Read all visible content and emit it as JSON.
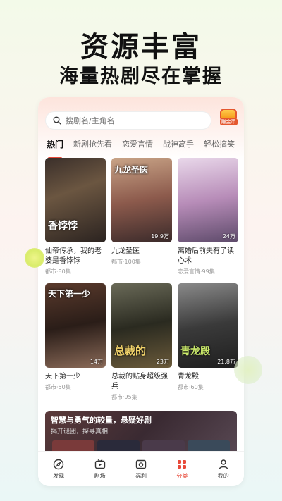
{
  "promo": {
    "title": "资源丰富",
    "subtitle": "海量热剧尽在掌握"
  },
  "search": {
    "placeholder": "搜剧名/主角名"
  },
  "coin_button": {
    "label": "赚金币"
  },
  "tabs": [
    {
      "label": "热门",
      "active": true
    },
    {
      "label": "新剧抢先看",
      "active": false
    },
    {
      "label": "恋爱言情",
      "active": false
    },
    {
      "label": "战神高手",
      "active": false
    },
    {
      "label": "轻松搞笑",
      "active": false
    }
  ],
  "dramas": [
    {
      "title": "仙帝传承，我的老婆是香饽饽",
      "meta": "都市·80集",
      "views": "",
      "poster_text": "香饽饽"
    },
    {
      "title": "九龙圣医",
      "meta": "都市·100集",
      "views": "19.9万",
      "poster_text": "九龙圣医"
    },
    {
      "title": "离婚后前夫有了读心术",
      "meta": "恋爱言情·99集",
      "views": "24万",
      "poster_text": ""
    },
    {
      "title": "天下第一少",
      "meta": "都市·50集",
      "views": "14万",
      "poster_text": "天下第一少"
    },
    {
      "title": "总裁的贴身超级强兵",
      "meta": "都市·95集",
      "views": "23万",
      "poster_text": "总裁的"
    },
    {
      "title": "青龙殿",
      "meta": "都市·60集",
      "views": "21.8万",
      "poster_text": "青龙殿"
    }
  ],
  "banner": {
    "title": "智慧与勇气的较量，悬疑好剧",
    "subtitle": "揭开谜团，探寻真相"
  },
  "bottom_nav": [
    {
      "label": "发现",
      "icon": "compass-icon",
      "active": false
    },
    {
      "label": "剧场",
      "icon": "tv-icon",
      "active": false
    },
    {
      "label": "福利",
      "icon": "gift-icon",
      "active": false
    },
    {
      "label": "分类",
      "icon": "grid-icon",
      "active": true
    },
    {
      "label": "我的",
      "icon": "person-icon",
      "active": false
    }
  ],
  "colors": {
    "accent": "#e84a3a"
  }
}
